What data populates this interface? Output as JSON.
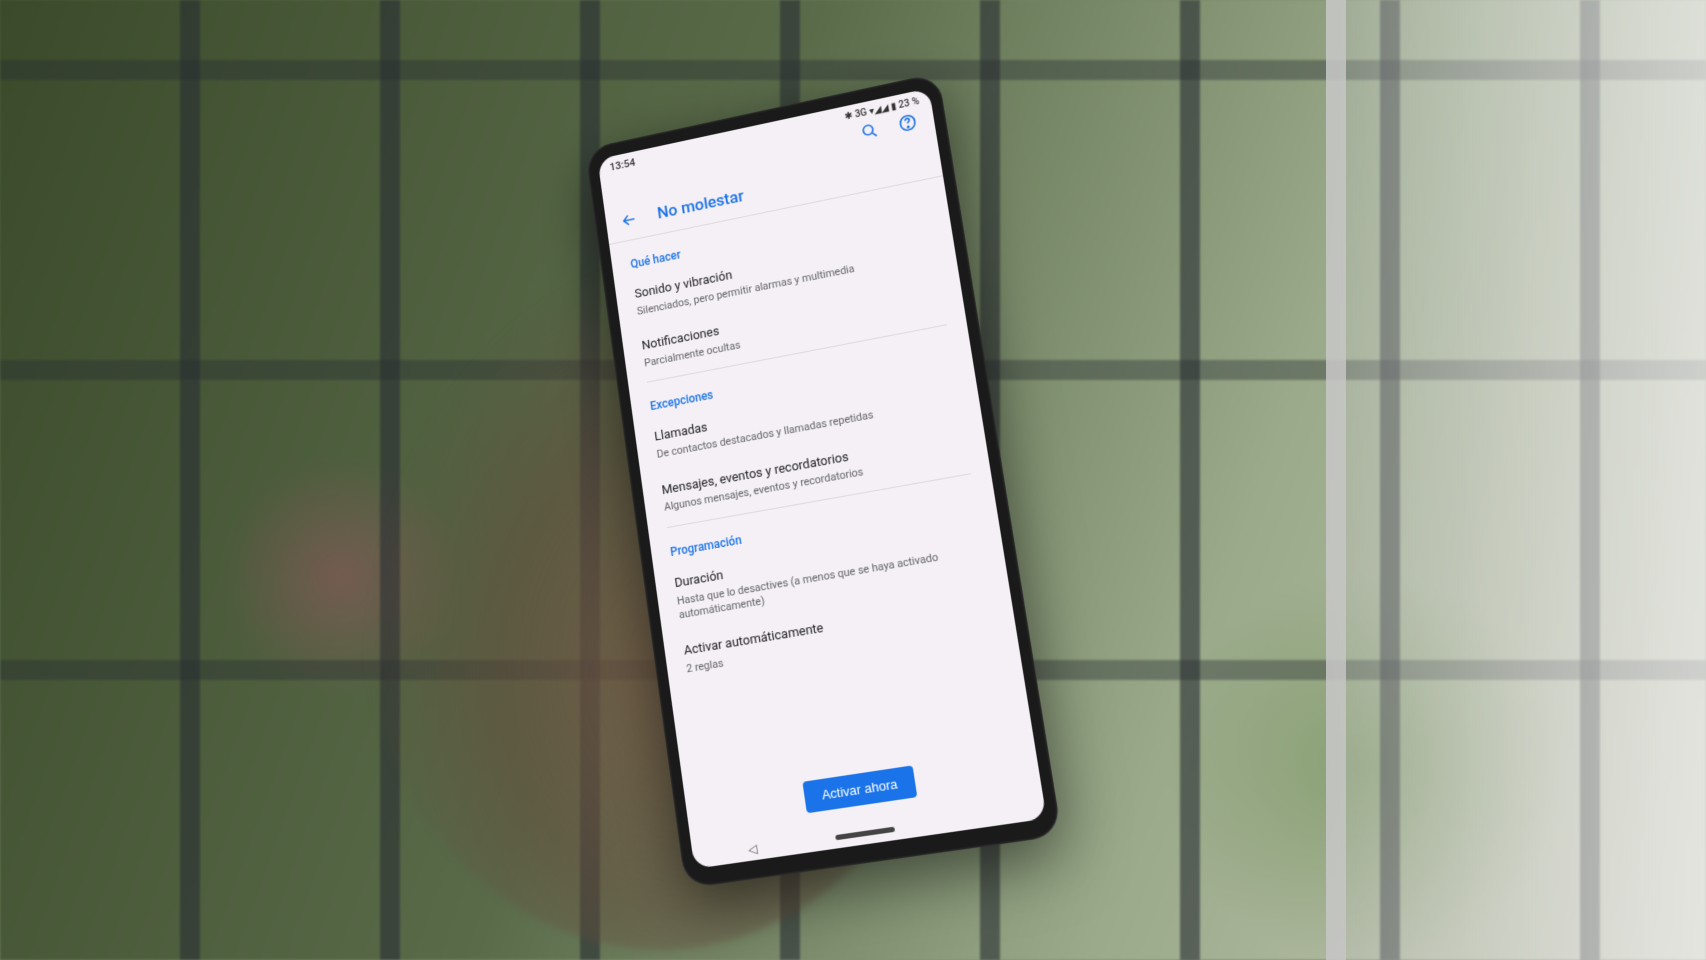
{
  "status_bar": {
    "time": "13:54",
    "icons_text": "✱ 3G ▾◢◢ ▮ 23 %"
  },
  "header": {
    "title": "No molestar"
  },
  "sections": {
    "what_to_do": {
      "label": "Qué hacer",
      "sound": {
        "title": "Sonido y vibración",
        "sub": "Silenciados, pero permitir alarmas y multimedia"
      },
      "notifications": {
        "title": "Notificaciones",
        "sub": "Parcialmente ocultas"
      }
    },
    "exceptions": {
      "label": "Excepciones",
      "calls": {
        "title": "Llamadas",
        "sub": "De contactos destacados y llamadas repetidas"
      },
      "messages": {
        "title": "Mensajes, eventos y recordatorios",
        "sub": "Algunos mensajes, eventos y recordatorios"
      }
    },
    "schedule": {
      "label": "Programación",
      "duration": {
        "title": "Duración",
        "sub": "Hasta que lo desactives (a menos que se haya activado automáticamente)"
      },
      "auto": {
        "title": "Activar automáticamente",
        "sub": "2 reglas"
      }
    }
  },
  "button": {
    "activate": "Activar ahora"
  }
}
